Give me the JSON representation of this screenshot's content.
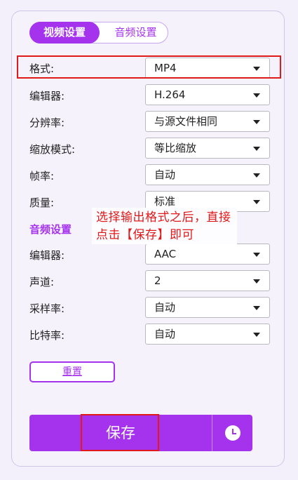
{
  "tabs": {
    "video": "视频设置",
    "audio": "音频设置"
  },
  "video": {
    "format": {
      "label": "格式:",
      "value": "MP4"
    },
    "encoder": {
      "label": "编辑器:",
      "value": "H.264"
    },
    "resolution": {
      "label": "分辨率:",
      "value": "与源文件相同"
    },
    "scale_mode": {
      "label": "缩放模式:",
      "value": "等比缩放"
    },
    "frame_rate": {
      "label": "帧率:",
      "value": "自动"
    },
    "quality": {
      "label": "质量:",
      "value": "标准"
    }
  },
  "audio": {
    "section_title": "音频设置",
    "encoder": {
      "label": "编辑器:",
      "value": "AAC"
    },
    "channels": {
      "label": "声道:",
      "value": "2"
    },
    "sample_rate": {
      "label": "采样率:",
      "value": "自动"
    },
    "bitrate": {
      "label": "比特率:",
      "value": "自动"
    }
  },
  "annotation": "选择输出格式之后，直接点击【保存】即可",
  "buttons": {
    "reset": "重置",
    "save": "保存"
  },
  "colors": {
    "accent": "#a533ee",
    "highlight": "#e01a1a"
  },
  "icons": {
    "history": "clock-icon",
    "dropdown": "caret-down-icon"
  }
}
